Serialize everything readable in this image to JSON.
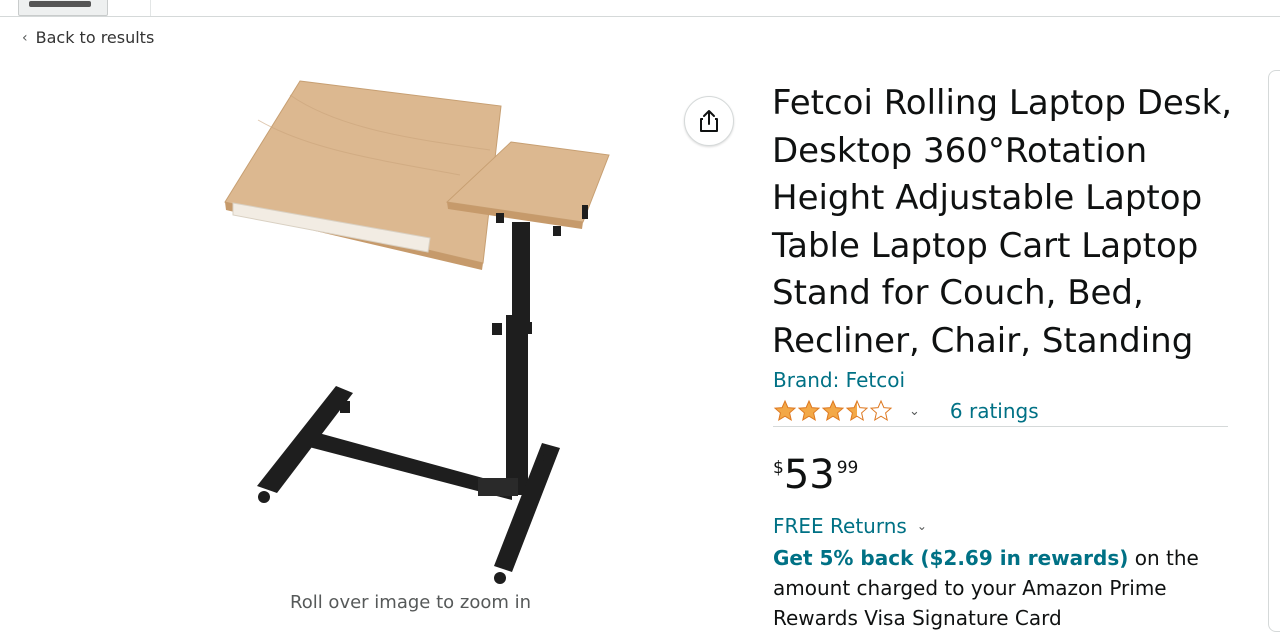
{
  "nav": {
    "back_label": "Back to results"
  },
  "product": {
    "title": "Fetcoi Rolling Laptop Desk, Desktop 360°Rotation Height Adjustable Laptop Table Laptop Cart Laptop Stand for Couch, Bed, Recliner, Chair, Standing",
    "brand_label": "Brand: Fetcoi",
    "rating": 3.5,
    "rating_max": 5,
    "ratings_count_label": "6 ratings",
    "price": {
      "symbol": "$",
      "whole": "53",
      "fraction": "99"
    },
    "returns_label": "FREE Returns",
    "rewards_link": "Get 5% back ($2.69 in rewards)",
    "rewards_text": "on the amount charged to your Amazon Prime Rewards Visa Signature Card"
  },
  "image": {
    "zoom_hint": "Roll over image to zoom in"
  },
  "icons": {
    "share": "share-icon",
    "star": "star-icon",
    "chevron": "chevron-down-icon"
  },
  "colors": {
    "link": "#007185",
    "star": "#f3a847",
    "text": "#0f1111",
    "wood": "#dcb890",
    "metal": "#1e1e1e"
  }
}
